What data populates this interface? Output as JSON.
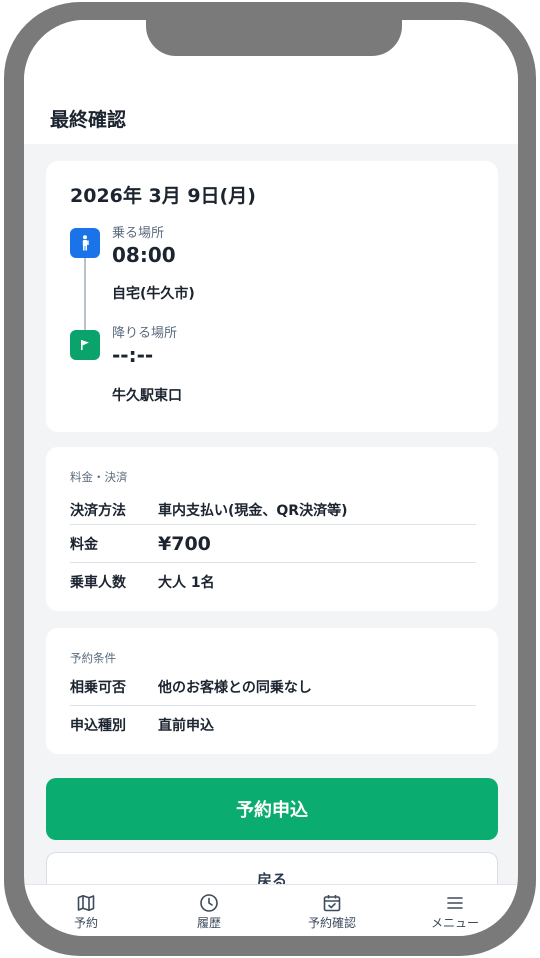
{
  "header": {
    "title": "最終確認"
  },
  "trip": {
    "date": "2026年 3月 9日(月)",
    "pickup": {
      "label": "乗る場所",
      "time": "08:00",
      "place": "自宅(牛久市)"
    },
    "dropoff": {
      "label": "降りる場所",
      "time": "--:--",
      "place": "牛久駅東口"
    }
  },
  "fare": {
    "section_label": "料金・決済",
    "rows": [
      {
        "key": "決済方法",
        "value": "車内支払い(現金、QR決済等)"
      },
      {
        "key": "料金",
        "value": "¥700"
      },
      {
        "key": "乗車人数",
        "value": "大人 1名"
      }
    ]
  },
  "conditions": {
    "section_label": "予約条件",
    "rows": [
      {
        "key": "相乗可否",
        "value": "他のお客様との同乗なし"
      },
      {
        "key": "申込種別",
        "value": "直前申込"
      }
    ]
  },
  "actions": {
    "submit_label": "予約申込",
    "back_label": "戻る"
  },
  "tabbar": {
    "items": [
      {
        "label": "予約",
        "icon": "map-icon"
      },
      {
        "label": "履歴",
        "icon": "clock-icon"
      },
      {
        "label": "予約確認",
        "icon": "calendar-check-icon"
      },
      {
        "label": "メニュー",
        "icon": "menu-icon"
      }
    ]
  },
  "colors": {
    "primary_green": "#0aad6f",
    "pickup_blue": "#1a73e8",
    "dropoff_green": "#0aa36b",
    "frame_gray": "#7a7a7a"
  }
}
